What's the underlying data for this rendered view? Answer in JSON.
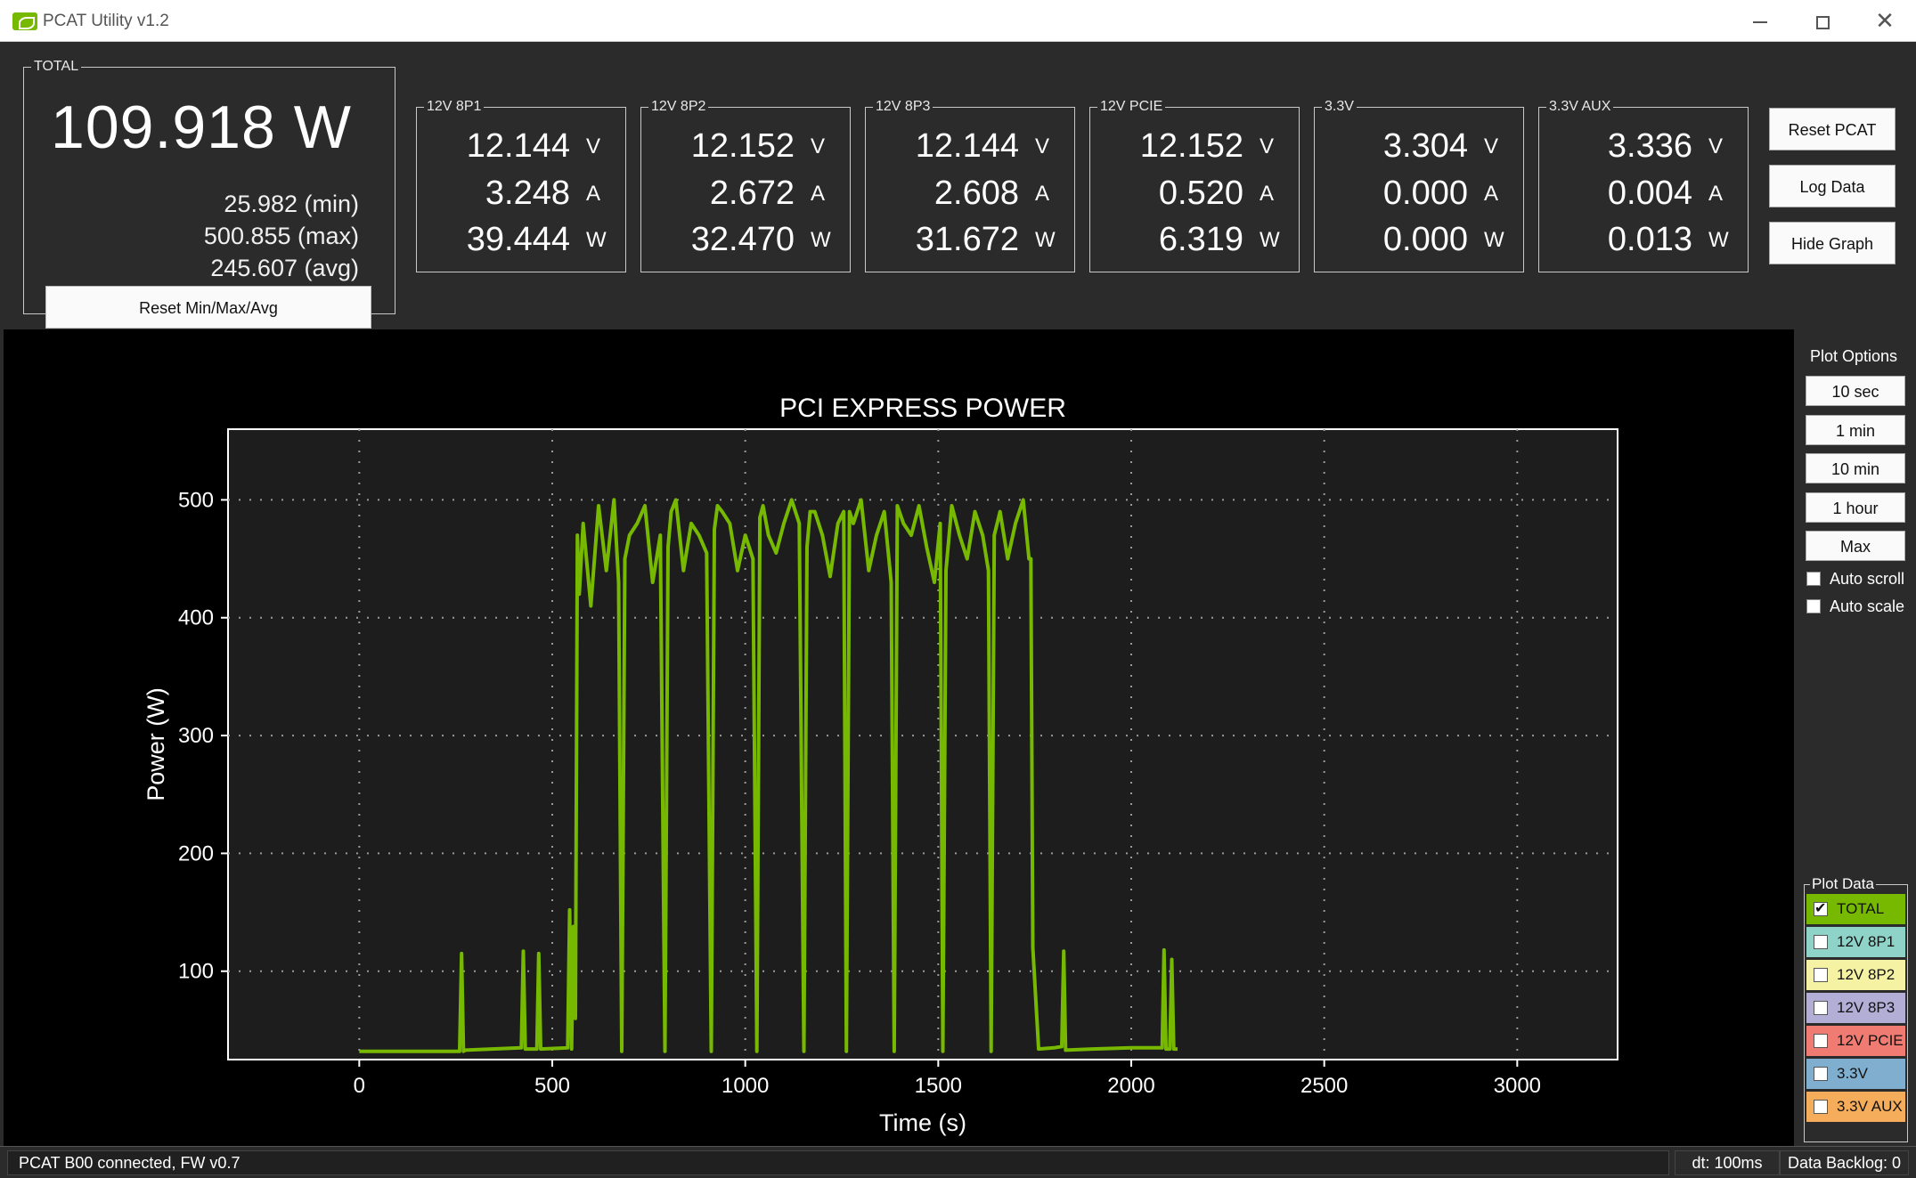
{
  "window": {
    "title": "PCAT Utility v1.2"
  },
  "total": {
    "label": "TOTAL",
    "value": "109.918 W",
    "min": "25.982 (min)",
    "max": "500.855 (max)",
    "avg": "245.607 (avg)",
    "reset_label": "Reset Min/Max/Avg"
  },
  "rails": [
    {
      "label": "12V 8P1",
      "v": "12.144",
      "a": "3.248",
      "w": "39.444"
    },
    {
      "label": "12V 8P2",
      "v": "12.152",
      "a": "2.672",
      "w": "32.470"
    },
    {
      "label": "12V 8P3",
      "v": "12.144",
      "a": "2.608",
      "w": "31.672"
    },
    {
      "label": "12V PCIE",
      "v": "12.152",
      "a": "0.520",
      "w": "6.319"
    },
    {
      "label": "3.3V",
      "v": "3.304",
      "a": "0.000",
      "w": "0.000"
    },
    {
      "label": "3.3V AUX",
      "v": "3.336",
      "a": "0.004",
      "w": "0.013"
    }
  ],
  "units": {
    "v": "V",
    "a": "A",
    "w": "W"
  },
  "actions": {
    "reset_pcat": "Reset PCAT",
    "log_data": "Log Data",
    "hide_graph": "Hide Graph"
  },
  "plot_options": {
    "title": "Plot Options",
    "buttons": [
      "10 sec",
      "1 min",
      "10 min",
      "1 hour",
      "Max"
    ],
    "auto_scroll": {
      "label": "Auto scroll",
      "checked": false
    },
    "auto_scale": {
      "label": "Auto scale",
      "checked": false
    }
  },
  "plot_data": {
    "title": "Plot Data",
    "items": [
      {
        "label": "TOTAL",
        "color": "#76b900",
        "checked": true
      },
      {
        "label": "12V 8P1",
        "color": "#8fd3c8",
        "checked": false
      },
      {
        "label": "12V 8P2",
        "color": "#f5f2a3",
        "checked": false
      },
      {
        "label": "12V 8P3",
        "color": "#b3aed6",
        "checked": false
      },
      {
        "label": "12V PCIE",
        "color": "#ef7b72",
        "checked": false
      },
      {
        "label": "3.3V",
        "color": "#7faecf",
        "checked": false
      },
      {
        "label": "3.3V AUX",
        "color": "#f5ad5b",
        "checked": false
      }
    ]
  },
  "status": {
    "connection": "PCAT B00 connected, FW v0.7",
    "dt": "dt: 100ms",
    "backlog": "Data Backlog: 0"
  },
  "chart_data": {
    "type": "line",
    "title": "PCI EXPRESS POWER",
    "xlabel": "Time (s)",
    "ylabel": "Power (W)",
    "xlim": [
      -340,
      3260
    ],
    "ylim": [
      25,
      560
    ],
    "xticks": [
      0,
      500,
      1000,
      1500,
      2000,
      2500,
      3000
    ],
    "yticks": [
      100,
      200,
      300,
      400,
      500
    ],
    "grid": true,
    "series": [
      {
        "color": "#76b900",
        "x": [
          0,
          260,
          265,
          270,
          275,
          420,
          425,
          430,
          460,
          465,
          470,
          540,
          545,
          550,
          555,
          560,
          565,
          570,
          575,
          580,
          600,
          620,
          640,
          660,
          672,
          680,
          688,
          700,
          720,
          740,
          760,
          780,
          792,
          800,
          808,
          820,
          840,
          860,
          880,
          900,
          912,
          920,
          928,
          940,
          960,
          980,
          1000,
          1020,
          1030,
          1038,
          1046,
          1060,
          1080,
          1100,
          1120,
          1140,
          1152,
          1160,
          1168,
          1180,
          1200,
          1220,
          1240,
          1255,
          1262,
          1270,
          1280,
          1300,
          1320,
          1340,
          1360,
          1378,
          1386,
          1394,
          1410,
          1430,
          1450,
          1470,
          1490,
          1505,
          1512,
          1520,
          1535,
          1555,
          1575,
          1595,
          1615,
          1630,
          1637,
          1645,
          1660,
          1680,
          1700,
          1720,
          1735,
          1740,
          1745,
          1760,
          1800,
          1820,
          1825,
          1830,
          1900,
          2000,
          2080,
          2085,
          2090,
          2100,
          2105,
          2110,
          2120
        ],
        "y": [
          32,
          32,
          115,
          32,
          33,
          35,
          117,
          34,
          34,
          115,
          34,
          35,
          152,
          34,
          138,
          60,
          470,
          420,
          450,
          480,
          410,
          495,
          440,
          500,
          430,
          32,
          450,
          470,
          480,
          495,
          430,
          470,
          32,
          460,
          490,
          500,
          440,
          480,
          470,
          455,
          32,
          475,
          495,
          490,
          480,
          440,
          470,
          450,
          32,
          485,
          495,
          470,
          455,
          480,
          500,
          480,
          32,
          460,
          490,
          490,
          470,
          435,
          480,
          490,
          32,
          490,
          480,
          500,
          440,
          470,
          490,
          430,
          32,
          495,
          480,
          470,
          495,
          460,
          430,
          480,
          32,
          440,
          495,
          470,
          450,
          490,
          470,
          440,
          32,
          470,
          490,
          450,
          480,
          500,
          450,
          450,
          120,
          34,
          35,
          36,
          117,
          33,
          34,
          35,
          35,
          118,
          34,
          34,
          110,
          34,
          34
        ]
      }
    ]
  }
}
